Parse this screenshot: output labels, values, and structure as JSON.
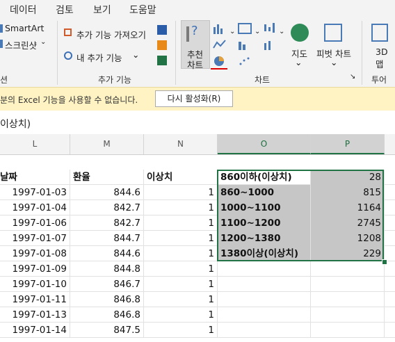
{
  "menu_tabs": [
    "데이터",
    "검토",
    "보기",
    "도움말"
  ],
  "ribbon": {
    "smartart": "SmartArt",
    "screenshot": "스크린샷",
    "get_addins": "추가 기능 가져오기",
    "my_addins": "내 추가 기능",
    "recommended_charts_line1": "추천",
    "recommended_charts_line2": "차트",
    "maps": "지도",
    "pivot_chart": "피벗 차트",
    "map3d_line1": "3D",
    "map3d_line2": "맵",
    "groups": {
      "illustrations_partial": "션",
      "addins": "추가 기능",
      "charts": "차트",
      "tours_partial": "투어"
    }
  },
  "message_bar": {
    "text": "분의 Excel 기능을 사용할 수 없습니다.",
    "button": "다시 활성화(R)"
  },
  "formula_bar": {
    "content": "이상치)"
  },
  "columns": [
    "L",
    "M",
    "N",
    "O",
    "P"
  ],
  "header_row": {
    "L": "날짜",
    "M": "환율",
    "N": "이상치"
  },
  "rows": [
    {
      "date": "1997-01-03",
      "rate": "844.6",
      "flag": "1",
      "range": "860이하(이상치)",
      "count": "28"
    },
    {
      "date": "1997-01-04",
      "rate": "842.7",
      "flag": "1",
      "range": "860~1000",
      "count": "815"
    },
    {
      "date": "1997-01-06",
      "rate": "842.7",
      "flag": "1",
      "range": "1000~1100",
      "count": "1164"
    },
    {
      "date": "1997-01-07",
      "rate": "844.7",
      "flag": "1",
      "range": "1100~1200",
      "count": "2745"
    },
    {
      "date": "1997-01-08",
      "rate": "844.6",
      "flag": "1",
      "range": "1200~1380",
      "count": "1208"
    },
    {
      "date": "1997-01-09",
      "rate": "844.8",
      "flag": "1",
      "range": "1380이상(이상치)",
      "count": "229"
    },
    {
      "date": "1997-01-10",
      "rate": "846.7",
      "flag": "1"
    },
    {
      "date": "1997-01-11",
      "rate": "846.8",
      "flag": "1"
    },
    {
      "date": "1997-01-13",
      "rate": "846.8",
      "flag": "1"
    },
    {
      "date": "1997-01-14",
      "rate": "847.5",
      "flag": "1"
    }
  ]
}
